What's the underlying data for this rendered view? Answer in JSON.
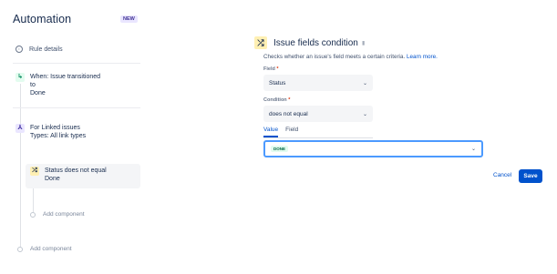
{
  "sidebar": {
    "title": "Automation",
    "badge": "NEW",
    "rule_details": "Rule details",
    "trigger": {
      "line1": "When: Issue transitioned",
      "line2": "to",
      "line3": "Done"
    },
    "branch": {
      "line1": "For Linked issues",
      "line2": "Types: All link types"
    },
    "condition": {
      "line1": "Status does not equal",
      "line2": "Done"
    },
    "add_component_inner": "Add component",
    "add_component_outer": "Add component"
  },
  "panel": {
    "title": "Issue fields condition",
    "description": "Checks whether an issue's field meets a certain criteria.",
    "learn_more": "Learn more.",
    "field_label": "Field",
    "field_value": "Status",
    "condition_label": "Condition",
    "condition_value": "does not equal",
    "required_mark": "*",
    "tabs": [
      "Value",
      "Field"
    ],
    "value_selected": "DONE",
    "cancel_label": "Cancel",
    "save_label": "Save"
  },
  "colors": {
    "primary": "#0052cc",
    "trigger_icon": "#e3fcef",
    "branch_icon": "#eae6ff",
    "condition_icon": "#fff0b3"
  },
  "icons": {
    "info": "info-icon",
    "trigger": "transition-icon",
    "branch": "branch-icon",
    "condition": "shuffle-icon",
    "trash": "trash-icon",
    "chevron": "chevron-down-icon"
  }
}
